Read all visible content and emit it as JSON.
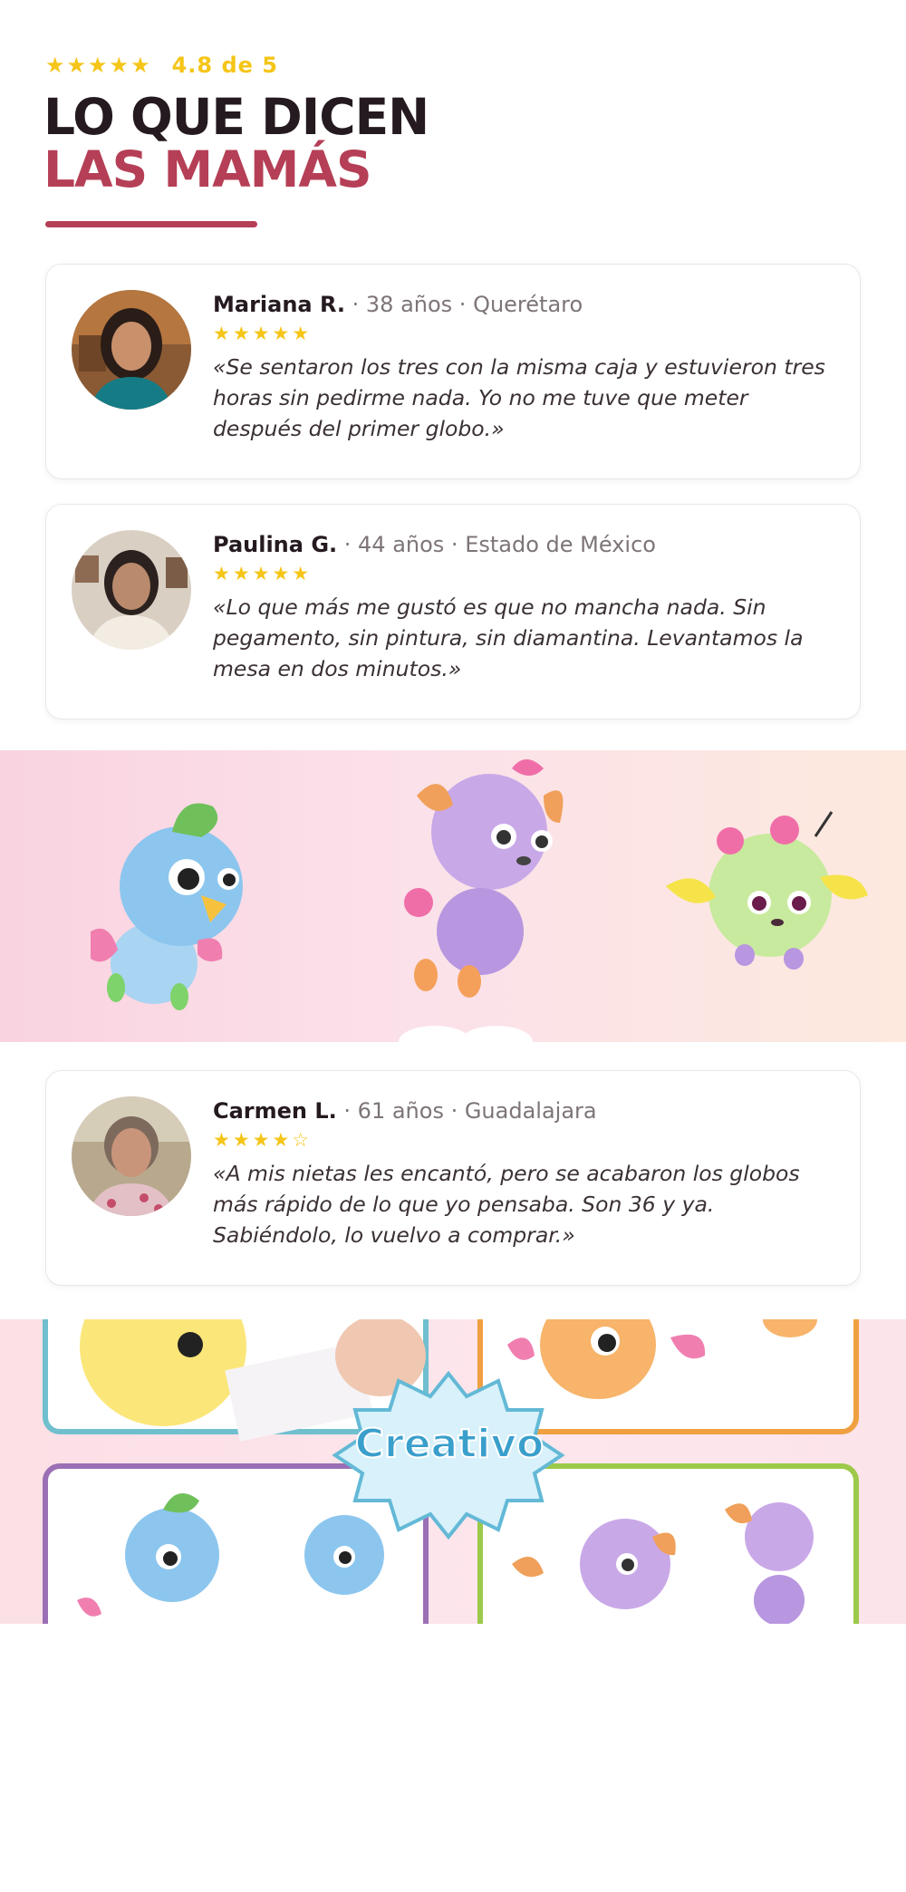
{
  "rating": {
    "stars": "★★★★★",
    "text": "4.8 de 5"
  },
  "heading": {
    "line1": "LO QUE DICEN",
    "line2": "LAS MAMÁS"
  },
  "reviews": [
    {
      "name": "Mariana R.",
      "details": " · 38 años · Querétaro",
      "stars": "★★★★★",
      "quote": "«Se sentaron los tres con la misma caja y estuvieron tres horas sin pedirme nada. Yo no me tuve que meter después del primer globo.»"
    },
    {
      "name": "Paulina G.",
      "details": " · 44 años · Estado de México",
      "stars": "★★★★★",
      "quote": "«Lo que más me gustó es que no mancha nada. Sin pegamento, sin pintura, sin diamantina. Levantamos la mesa en dos minutos.»"
    },
    {
      "name": "Carmen L.",
      "details": " · 61 años · Guadalajara",
      "stars": "★★★★☆",
      "quote": "«A mis nietas les encantó, pero se acabaron los globos más rápido de lo que yo pensaba. Son 36 y ya. Sabiéndolo, lo vuelvo a comprar.»"
    }
  ],
  "promo": {
    "badge": "Creativo"
  }
}
